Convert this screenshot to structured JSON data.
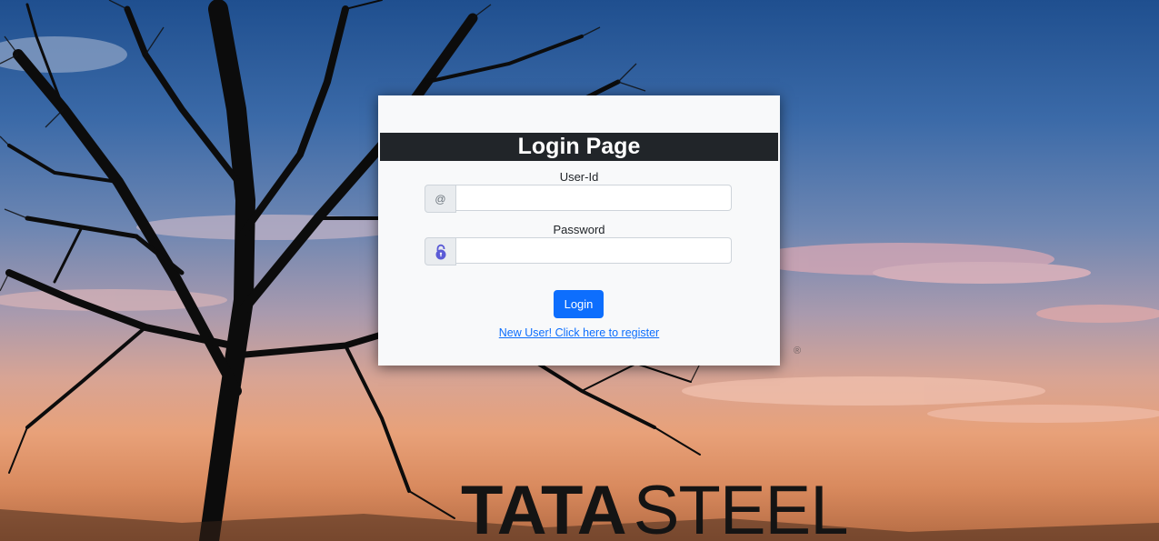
{
  "background": {
    "brand_text_bold": "TATA",
    "brand_text_regular": "STEEL",
    "registered_mark": "®"
  },
  "login": {
    "title": "Login Page",
    "user_id_label": "User-Id",
    "user_id_prefix": "@",
    "user_id_value": "",
    "password_label": "Password",
    "password_value": "",
    "password_prefix_icon": "lock-icon",
    "login_button": "Login",
    "register_link": "New User! Click here to register"
  },
  "colors": {
    "title_bar": "#212529",
    "primary": "#0d6efd",
    "card": "#f8f9fa",
    "lock_icon": "#5b5bd6"
  }
}
